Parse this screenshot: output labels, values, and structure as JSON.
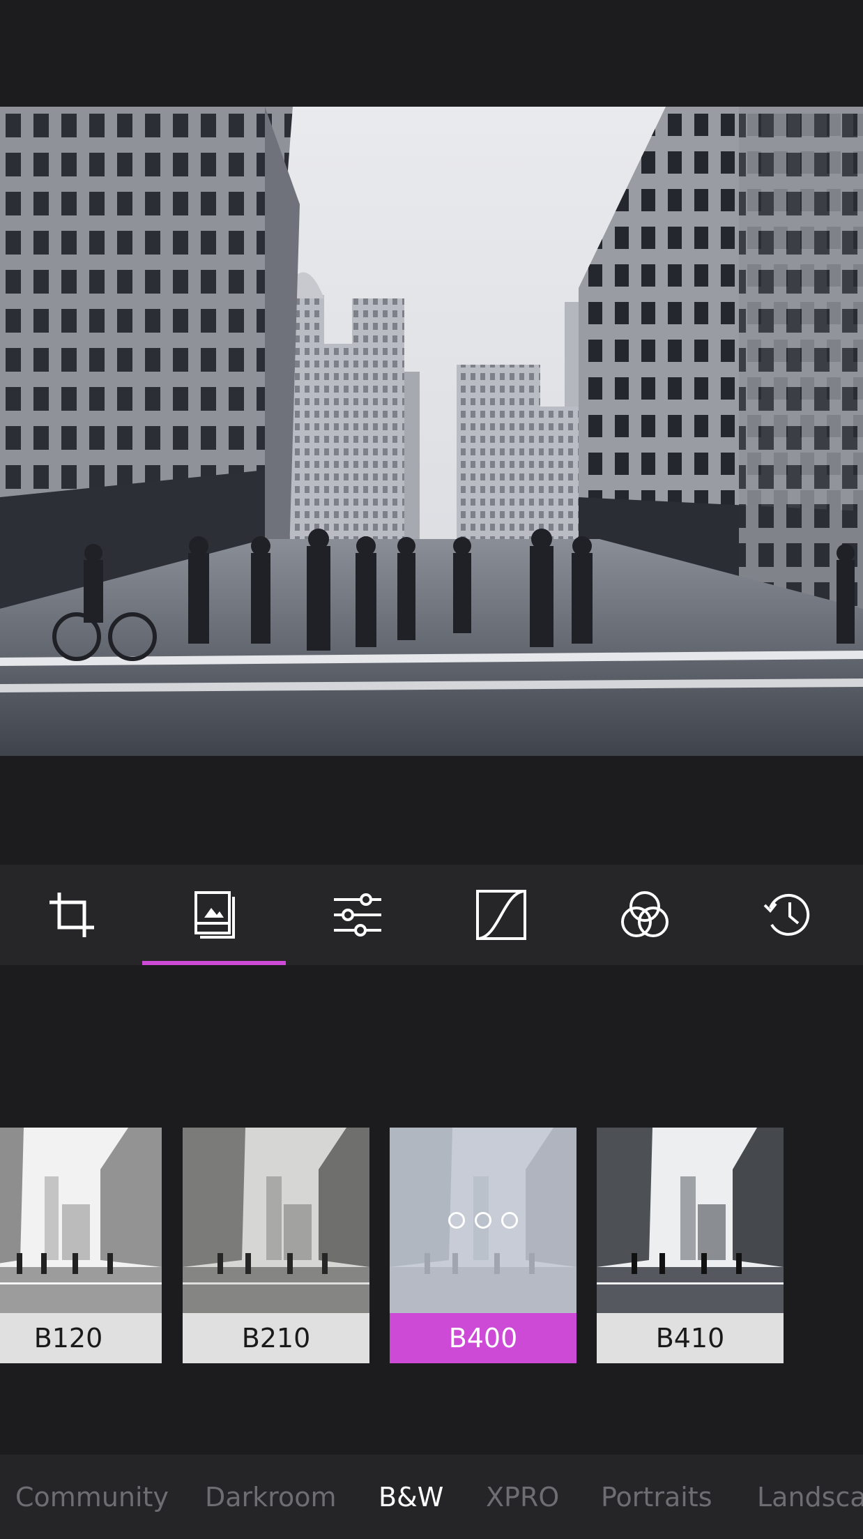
{
  "colors": {
    "background": "#1c1c1e",
    "toolbar": "#262628",
    "accent": "#cc4ad6",
    "category_inactive": "#6e6e72",
    "category_active": "#ffffff"
  },
  "toolbar": {
    "tools": [
      {
        "icon": "crop-icon",
        "active": false
      },
      {
        "icon": "filters-icon",
        "active": true
      },
      {
        "icon": "adjust-sliders-icon",
        "active": false
      },
      {
        "icon": "curves-icon",
        "active": false
      },
      {
        "icon": "color-circles-icon",
        "active": false
      },
      {
        "icon": "history-icon",
        "active": false
      }
    ]
  },
  "filters": {
    "items": [
      {
        "label": "B120",
        "selected": false
      },
      {
        "label": "B210",
        "selected": false
      },
      {
        "label": "B400",
        "selected": true,
        "options_icon": "more-options-icon"
      },
      {
        "label": "B410",
        "selected": false
      }
    ]
  },
  "categories": {
    "items": [
      {
        "label": "Community",
        "active": false
      },
      {
        "label": "Darkroom",
        "active": false
      },
      {
        "label": "B&W",
        "active": true
      },
      {
        "label": "XPRO",
        "active": false
      },
      {
        "label": "Portraits",
        "active": false
      },
      {
        "label": "Landsca",
        "active": false
      }
    ]
  }
}
